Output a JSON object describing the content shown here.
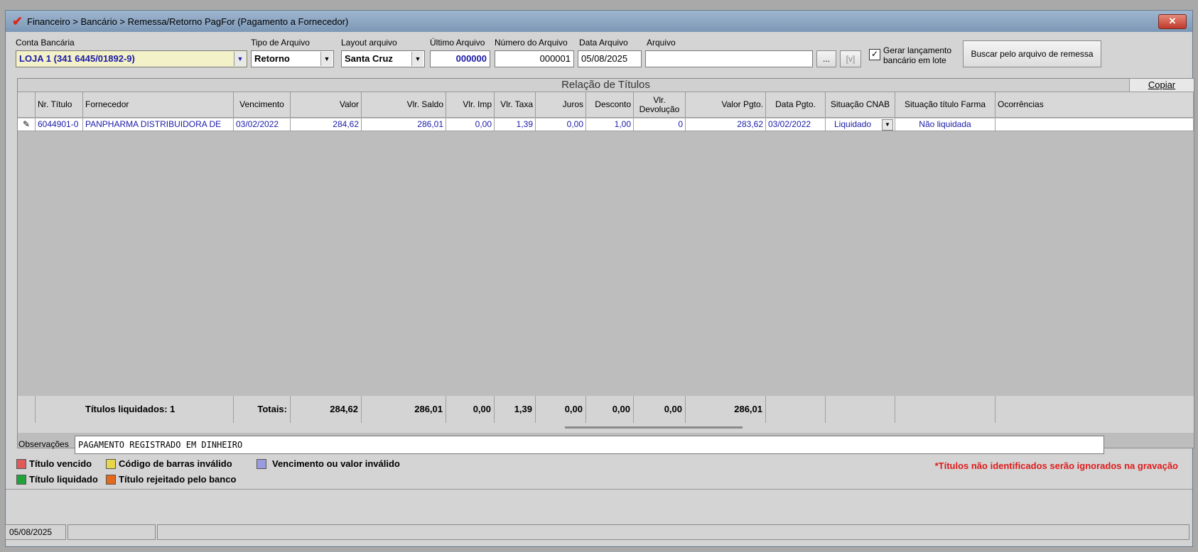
{
  "window": {
    "title": "Financeiro > Bancário > Remessa/Retorno PagFor (Pagamento  a Fornecedor)",
    "close": "✕"
  },
  "form": {
    "conta_label": "Conta Bancária",
    "conta_value": "LOJA 1 (341 6445/01892-9)",
    "tipo_label": "Tipo de Arquivo",
    "tipo_value": "Retorno",
    "layout_label": "Layout arquivo",
    "layout_value": "Santa Cruz",
    "ultimo_label": "Último Arquivo",
    "ultimo_value": "000000",
    "numero_label": "Número do Arquivo",
    "numero_value": "000001",
    "data_label": "Data Arquivo",
    "data_value": "05/08/2025",
    "arquivo_label": "Arquivo",
    "arquivo_value": "",
    "browse_label": "...",
    "view_label": "[v]",
    "gerar_label_1": "Gerar lançamento",
    "gerar_label_2": "bancário em lote",
    "gerar_checked": true,
    "buscar_label": "Buscar pelo arquivo de remessa"
  },
  "grid": {
    "title": "Relação de Títulos",
    "copy_label": "Copiar",
    "headers": [
      "Nr. Título",
      "Fornecedor",
      "Vencimento",
      "Valor",
      "Vlr. Saldo",
      "Vlr. Imp",
      "Vlr. Taxa",
      "Juros",
      "Desconto",
      "Vlr. Devolução",
      "Valor Pgto.",
      "Data Pgto.",
      "Situação CNAB",
      "Situação título Farma",
      "Ocorrências"
    ],
    "rows": [
      [
        "6044901-0",
        "PANPHARMA DISTRIBUIDORA DE",
        "03/02/2022",
        "284,62",
        "286,01",
        "0,00",
        "1,39",
        "0,00",
        "1,00",
        "0",
        "283,62",
        "03/02/2022",
        "Liquidado",
        "Não liquidada",
        ""
      ]
    ],
    "footer": {
      "liquidados": "Títulos liquidados: 1",
      "totais": "Totais:",
      "valor": "284,62",
      "saldo": "286,01",
      "imp": "0,00",
      "taxa": "1,39",
      "juros": "0,00",
      "desconto": "0,00",
      "devolucao": "0,00",
      "pgto": "286,01"
    }
  },
  "obs": {
    "label": "Observações",
    "value": "PAGAMENTO REGISTRADO EM DINHEIRO"
  },
  "legend": {
    "vencido": "Título vencido",
    "codigo": "Código de barras inválido",
    "venc_valor": "Vencimento ou valor inválido",
    "liquidado": "Título liquidado",
    "rejeitado": "Título rejeitado pelo banco",
    "warning": "*Títulos não identificados serão ignorados na gravação"
  },
  "colors": {
    "vencido": "#e05a5a",
    "codigo": "#e8d64a",
    "venc_valor": "#9a9ae0",
    "liquidado": "#21a33a",
    "rejeitado": "#e36a1c",
    "warning": "#e01b1b"
  },
  "status": {
    "date": "05/08/2025"
  }
}
